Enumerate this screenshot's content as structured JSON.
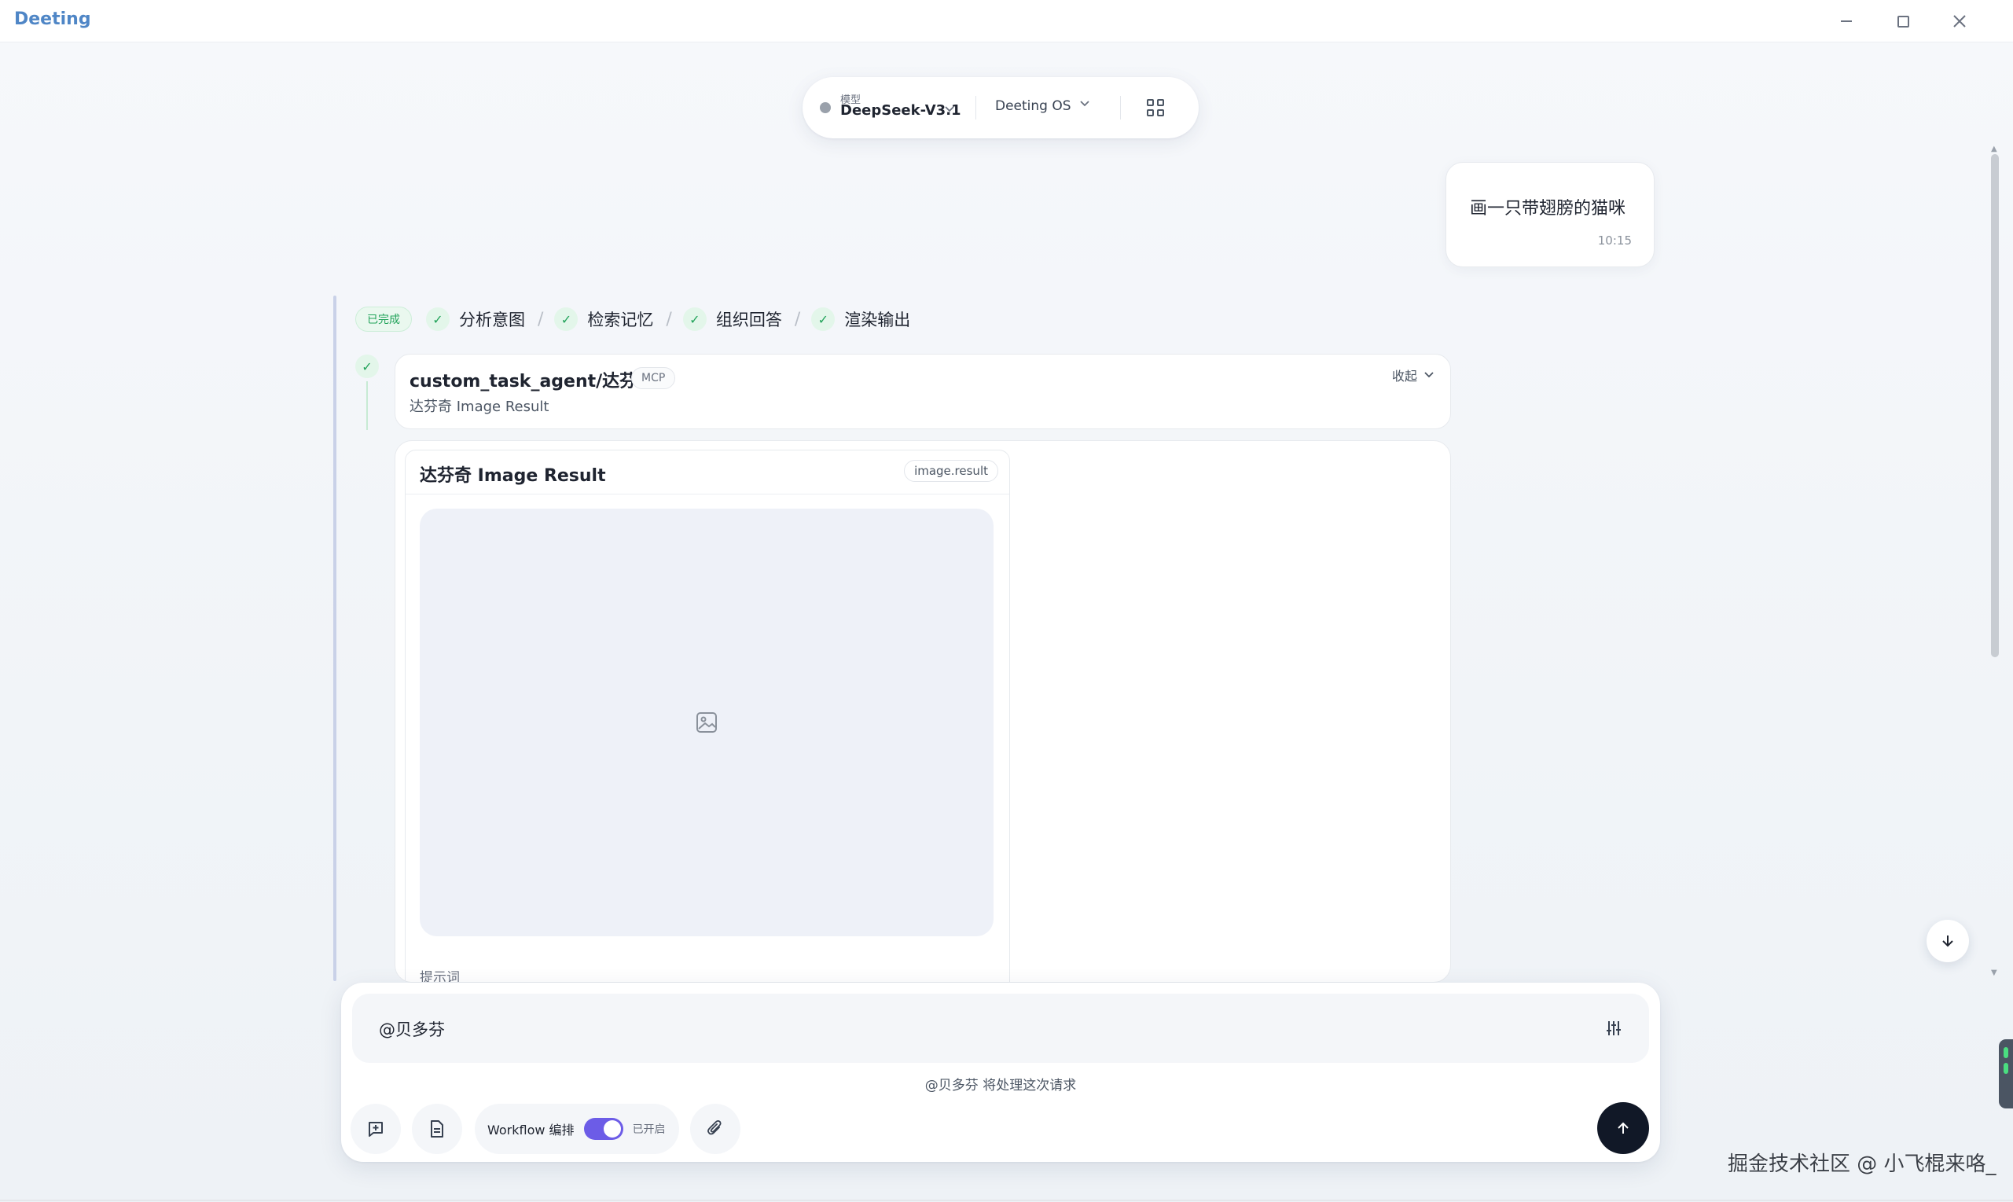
{
  "window": {
    "app_title": "Deeting",
    "controls": {
      "minimize": "minimize-icon",
      "maximize": "maximize-icon",
      "close": "close-icon"
    }
  },
  "model_bar": {
    "caption": "模型",
    "model_name": "DeepSeek-V3.1",
    "os_name": "Deeting OS",
    "status_color": "#9aa1ab"
  },
  "user_message": {
    "text": "画一只带翅膀的猫咪",
    "time": "10:15"
  },
  "steps": {
    "status_badge": "已完成",
    "items": [
      {
        "label": "分析意图"
      },
      {
        "label": "检索记忆"
      },
      {
        "label": "组织回答"
      },
      {
        "label": "渲染输出"
      }
    ],
    "separator": "/"
  },
  "tool_call": {
    "name": "custom_task_agent/达芬奇",
    "tag": "MCP",
    "subtitle": "达芬奇 Image Result",
    "collapse_label": "收起"
  },
  "result": {
    "title": "达芬奇 Image Result",
    "type_tag": "image.result",
    "prompt_label": "提示词"
  },
  "composer": {
    "input_value": "@贝多芬",
    "hint": "@贝多芬 将处理这次请求",
    "workflow_label": "Workflow 编排",
    "workflow_state": "已开启",
    "workflow_enabled": true,
    "accent_color": "#6c5ce7"
  },
  "watermark": "掘金技术社区 @ 小飞棍来咯_"
}
